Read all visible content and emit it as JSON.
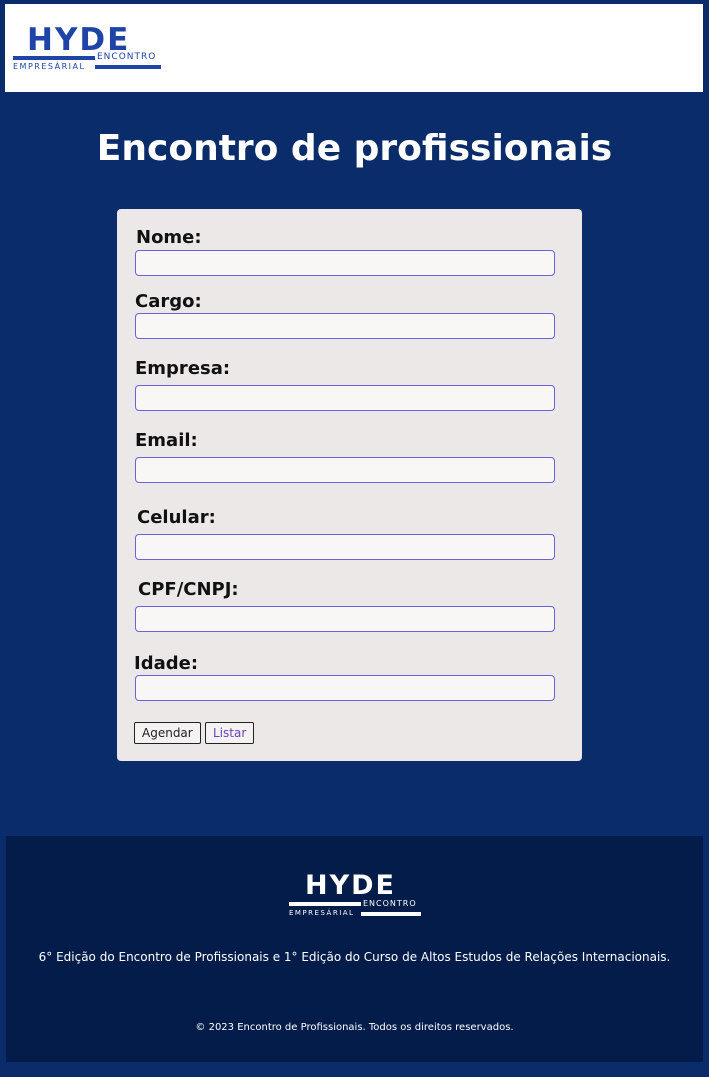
{
  "header": {
    "logo": {
      "word": "HYDE",
      "encontro": "ENCONTRO",
      "empresarial": "EMPRESÁRIAL"
    }
  },
  "page_title": "Encontro de profissionais",
  "form": {
    "fields": [
      {
        "label": "Nome:",
        "value": ""
      },
      {
        "label": "Cargo:",
        "value": ""
      },
      {
        "label": "Empresa:",
        "value": ""
      },
      {
        "label": "Email:",
        "value": ""
      },
      {
        "label": "Celular:",
        "value": ""
      },
      {
        "label": "CPF/CNPJ:",
        "value": ""
      },
      {
        "label": "Idade:",
        "value": ""
      }
    ],
    "buttons": {
      "agendar": "Agendar",
      "listar": "Listar"
    }
  },
  "footer": {
    "logo": {
      "word": "HYDE",
      "encontro": "ENCONTRO",
      "empresarial": "EMPRESÁRIAL"
    },
    "description": "6° Edição do Encontro de Profissionais e 1° Edição do Curso de Altos Estudos de Relações Internacionais.",
    "copyright": "© 2023 Encontro de Profissionais. Todos os direitos reservados."
  },
  "colors": {
    "background": "#0b2c6a",
    "footer": "#041c4a",
    "card": "#ede8e8",
    "brand": "#1d44a6",
    "input_border": "#6a62d6"
  }
}
